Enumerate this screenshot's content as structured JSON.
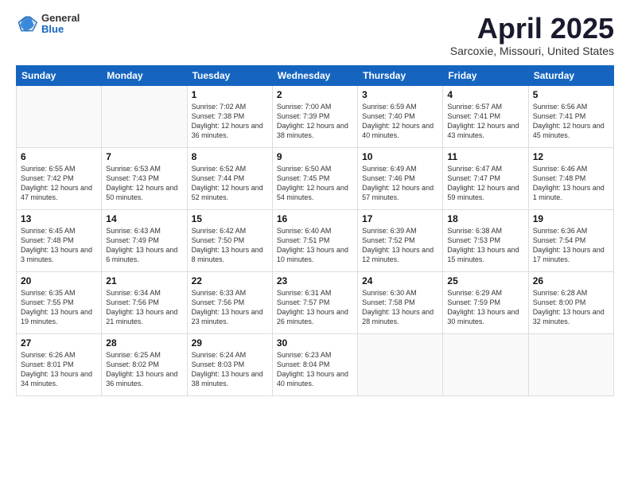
{
  "logo": {
    "line1": "General",
    "line2": "Blue"
  },
  "title": "April 2025",
  "subtitle": "Sarcoxie, Missouri, United States",
  "days_of_week": [
    "Sunday",
    "Monday",
    "Tuesday",
    "Wednesday",
    "Thursday",
    "Friday",
    "Saturday"
  ],
  "weeks": [
    [
      {
        "day": "",
        "info": ""
      },
      {
        "day": "",
        "info": ""
      },
      {
        "day": "1",
        "info": "Sunrise: 7:02 AM\nSunset: 7:38 PM\nDaylight: 12 hours and 36 minutes."
      },
      {
        "day": "2",
        "info": "Sunrise: 7:00 AM\nSunset: 7:39 PM\nDaylight: 12 hours and 38 minutes."
      },
      {
        "day": "3",
        "info": "Sunrise: 6:59 AM\nSunset: 7:40 PM\nDaylight: 12 hours and 40 minutes."
      },
      {
        "day": "4",
        "info": "Sunrise: 6:57 AM\nSunset: 7:41 PM\nDaylight: 12 hours and 43 minutes."
      },
      {
        "day": "5",
        "info": "Sunrise: 6:56 AM\nSunset: 7:41 PM\nDaylight: 12 hours and 45 minutes."
      }
    ],
    [
      {
        "day": "6",
        "info": "Sunrise: 6:55 AM\nSunset: 7:42 PM\nDaylight: 12 hours and 47 minutes."
      },
      {
        "day": "7",
        "info": "Sunrise: 6:53 AM\nSunset: 7:43 PM\nDaylight: 12 hours and 50 minutes."
      },
      {
        "day": "8",
        "info": "Sunrise: 6:52 AM\nSunset: 7:44 PM\nDaylight: 12 hours and 52 minutes."
      },
      {
        "day": "9",
        "info": "Sunrise: 6:50 AM\nSunset: 7:45 PM\nDaylight: 12 hours and 54 minutes."
      },
      {
        "day": "10",
        "info": "Sunrise: 6:49 AM\nSunset: 7:46 PM\nDaylight: 12 hours and 57 minutes."
      },
      {
        "day": "11",
        "info": "Sunrise: 6:47 AM\nSunset: 7:47 PM\nDaylight: 12 hours and 59 minutes."
      },
      {
        "day": "12",
        "info": "Sunrise: 6:46 AM\nSunset: 7:48 PM\nDaylight: 13 hours and 1 minute."
      }
    ],
    [
      {
        "day": "13",
        "info": "Sunrise: 6:45 AM\nSunset: 7:48 PM\nDaylight: 13 hours and 3 minutes."
      },
      {
        "day": "14",
        "info": "Sunrise: 6:43 AM\nSunset: 7:49 PM\nDaylight: 13 hours and 6 minutes."
      },
      {
        "day": "15",
        "info": "Sunrise: 6:42 AM\nSunset: 7:50 PM\nDaylight: 13 hours and 8 minutes."
      },
      {
        "day": "16",
        "info": "Sunrise: 6:40 AM\nSunset: 7:51 PM\nDaylight: 13 hours and 10 minutes."
      },
      {
        "day": "17",
        "info": "Sunrise: 6:39 AM\nSunset: 7:52 PM\nDaylight: 13 hours and 12 minutes."
      },
      {
        "day": "18",
        "info": "Sunrise: 6:38 AM\nSunset: 7:53 PM\nDaylight: 13 hours and 15 minutes."
      },
      {
        "day": "19",
        "info": "Sunrise: 6:36 AM\nSunset: 7:54 PM\nDaylight: 13 hours and 17 minutes."
      }
    ],
    [
      {
        "day": "20",
        "info": "Sunrise: 6:35 AM\nSunset: 7:55 PM\nDaylight: 13 hours and 19 minutes."
      },
      {
        "day": "21",
        "info": "Sunrise: 6:34 AM\nSunset: 7:56 PM\nDaylight: 13 hours and 21 minutes."
      },
      {
        "day": "22",
        "info": "Sunrise: 6:33 AM\nSunset: 7:56 PM\nDaylight: 13 hours and 23 minutes."
      },
      {
        "day": "23",
        "info": "Sunrise: 6:31 AM\nSunset: 7:57 PM\nDaylight: 13 hours and 26 minutes."
      },
      {
        "day": "24",
        "info": "Sunrise: 6:30 AM\nSunset: 7:58 PM\nDaylight: 13 hours and 28 minutes."
      },
      {
        "day": "25",
        "info": "Sunrise: 6:29 AM\nSunset: 7:59 PM\nDaylight: 13 hours and 30 minutes."
      },
      {
        "day": "26",
        "info": "Sunrise: 6:28 AM\nSunset: 8:00 PM\nDaylight: 13 hours and 32 minutes."
      }
    ],
    [
      {
        "day": "27",
        "info": "Sunrise: 6:26 AM\nSunset: 8:01 PM\nDaylight: 13 hours and 34 minutes."
      },
      {
        "day": "28",
        "info": "Sunrise: 6:25 AM\nSunset: 8:02 PM\nDaylight: 13 hours and 36 minutes."
      },
      {
        "day": "29",
        "info": "Sunrise: 6:24 AM\nSunset: 8:03 PM\nDaylight: 13 hours and 38 minutes."
      },
      {
        "day": "30",
        "info": "Sunrise: 6:23 AM\nSunset: 8:04 PM\nDaylight: 13 hours and 40 minutes."
      },
      {
        "day": "",
        "info": ""
      },
      {
        "day": "",
        "info": ""
      },
      {
        "day": "",
        "info": ""
      }
    ]
  ]
}
